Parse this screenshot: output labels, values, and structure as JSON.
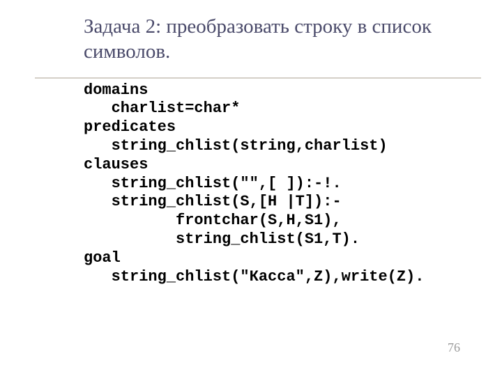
{
  "slide": {
    "title": "Задача 2: преобразовать строку в список символов.",
    "code": {
      "line1": "domains",
      "line2": "   charlist=char*",
      "line3": "predicates",
      "line4": "   string_chlist(string,charlist)",
      "line5": "clauses",
      "line6": "   string_chlist(\"\",[ ]):-!.",
      "line7": "   string_chlist(S,[H |T]):-",
      "line8": "          frontchar(S,H,S1),",
      "line9": "          string_chlist(S1,T).",
      "line10": "goal",
      "line11": "   string_chlist(\"Касса\",Z),write(Z)."
    },
    "page_number": "76"
  }
}
